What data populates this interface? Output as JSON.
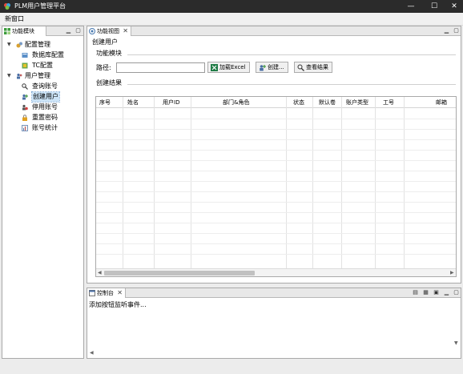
{
  "window": {
    "title": "PLM用户管理平台",
    "minimize": "—",
    "maximize": "☐",
    "close": "✕"
  },
  "menu": {
    "new_window": "新窗口"
  },
  "left_panel": {
    "tab_label": "功能模块",
    "tree": [
      {
        "label": "配置管理",
        "icon": "gears-icon",
        "expanded": true
      },
      {
        "label": "数据库配置",
        "icon": "database-icon"
      },
      {
        "label": "TC配置",
        "icon": "tc-config-icon"
      },
      {
        "label": "用户管理",
        "icon": "users-icon",
        "expanded": true
      },
      {
        "label": "查询账号",
        "icon": "search-user-icon"
      },
      {
        "label": "创建用户",
        "icon": "add-user-icon",
        "selected": true
      },
      {
        "label": "停用账号",
        "icon": "disable-user-icon"
      },
      {
        "label": "重置密码",
        "icon": "lock-icon"
      },
      {
        "label": "账号统计",
        "icon": "stats-icon"
      }
    ]
  },
  "main_panel": {
    "tab_label": "功能视图",
    "view_title": "创建用户",
    "section_function": "功能模块",
    "path_label": "路径:",
    "path_value": "",
    "buttons": {
      "load_excel": "加载Excel",
      "create": "创建...",
      "view_result": "查看结果"
    },
    "section_result": "创建结果",
    "columns": [
      "序号",
      "姓名",
      "用户ID",
      "部门&角色",
      "状态",
      "默认卷",
      "账户类型",
      "工号",
      "邮箱"
    ]
  },
  "console": {
    "tab_label": "控制台",
    "message": "添加按钮监听事件..."
  },
  "colors": {
    "titlebar": "#2b2b2b",
    "selection": "#cce4f7",
    "pane_border": "#a9a9a9"
  }
}
